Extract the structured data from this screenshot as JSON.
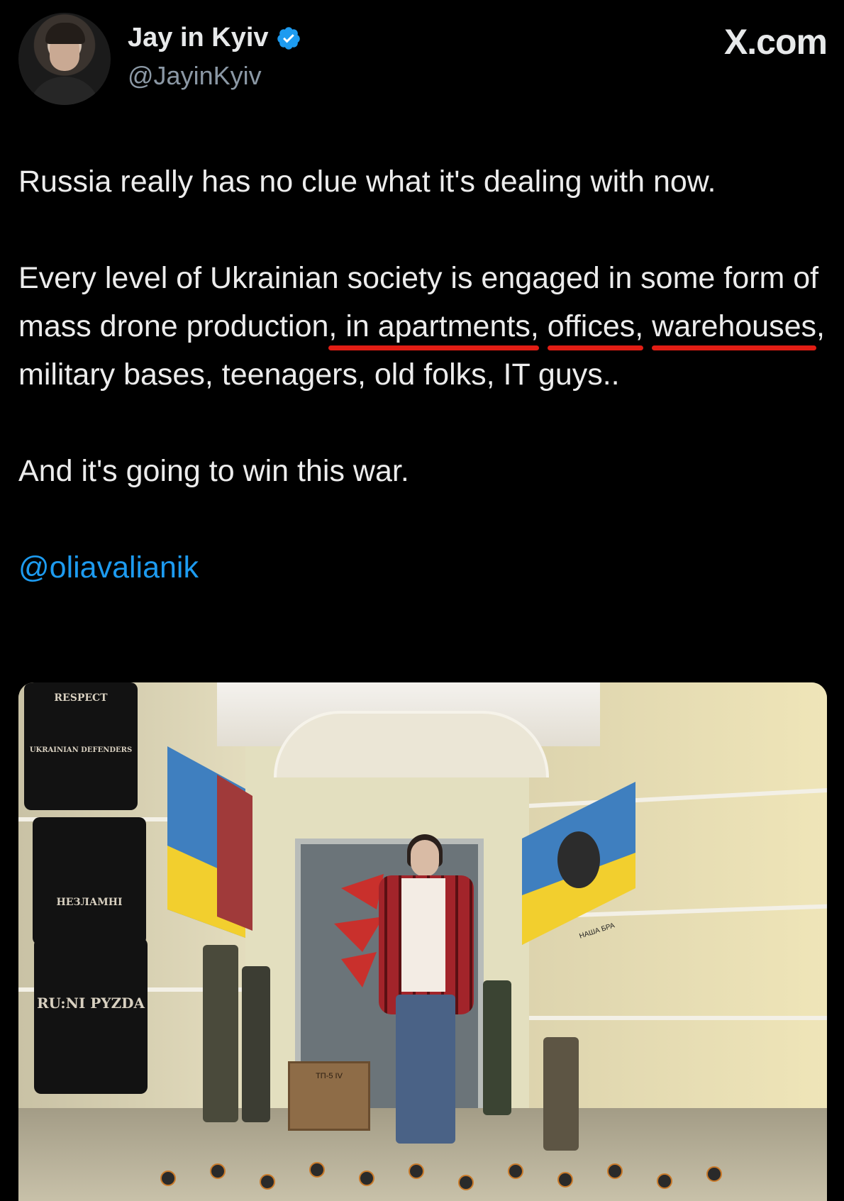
{
  "author": {
    "display_name": "Jay in Kyiv",
    "handle": "@JayinKyiv",
    "verified": true,
    "verified_icon": "verified-badge-icon",
    "verified_color": "#1d9bf0"
  },
  "brand": {
    "label": "X.com"
  },
  "tweet": {
    "p1": "Russia really has no clue what it's dealing with now.",
    "p2": {
      "a": "Every level of Ukrainian society is engaged in some form of mass drone production",
      "ul1": ", in apartments,",
      "ul2": "offices,",
      "sp": " ",
      "ul3": "warehouses",
      "b": ", military bases, teenagers, old folks, IT guys.."
    },
    "p3": "And it's going to win this war.",
    "mention": "@oliavalianik"
  },
  "colors": {
    "background": "#000000",
    "text": "#ececec",
    "handle": "#8b98a5",
    "link": "#1d9bf0",
    "underline_markup": "#e11d14"
  },
  "media": {
    "tshirt_texts": [
      "RESPECT",
      "UKRAINIAN DEFENDERS",
      "НЕЗЛАМНІ",
      "RU:NI PYZDA"
    ],
    "crate_text": "ТП-5 IV",
    "flag_text": "НАША БРА"
  }
}
